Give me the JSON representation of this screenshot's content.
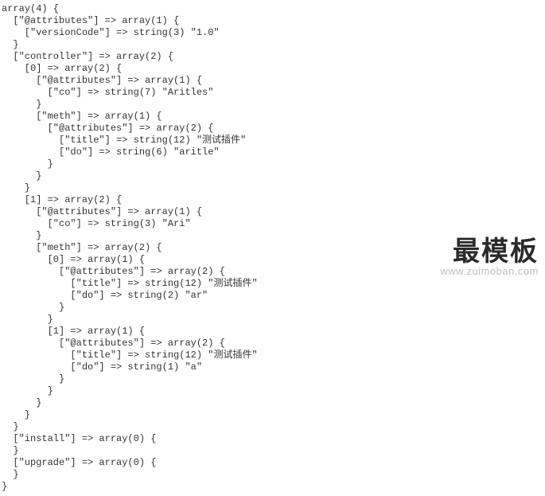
{
  "watermark": {
    "main": "最模板",
    "sub": "www.zuimoban.com"
  },
  "lines": [
    "array(4) {",
    "  [\"@attributes\"] => array(1) {",
    "    [\"versionCode\"] => string(3) \"1.0\"",
    "  }",
    "  [\"controller\"] => array(2) {",
    "    [0] => array(2) {",
    "      [\"@attributes\"] => array(1) {",
    "        [\"co\"] => string(7) \"Aritles\"",
    "      }",
    "      [\"meth\"] => array(1) {",
    "        [\"@attributes\"] => array(2) {",
    "          [\"title\"] => string(12) \"测试插件\"",
    "          [\"do\"] => string(6) \"aritle\"",
    "        }",
    "      }",
    "    }",
    "    [1] => array(2) {",
    "      [\"@attributes\"] => array(1) {",
    "        [\"co\"] => string(3) \"Ari\"",
    "      }",
    "      [\"meth\"] => array(2) {",
    "        [0] => array(1) {",
    "          [\"@attributes\"] => array(2) {",
    "            [\"title\"] => string(12) \"测试插件\"",
    "            [\"do\"] => string(2) \"ar\"",
    "          }",
    "        }",
    "        [1] => array(1) {",
    "          [\"@attributes\"] => array(2) {",
    "            [\"title\"] => string(12) \"测试插件\"",
    "            [\"do\"] => string(1) \"a\"",
    "          }",
    "        }",
    "      }",
    "    }",
    "  }",
    "  [\"install\"] => array(0) {",
    "  }",
    "  [\"upgrade\"] => array(0) {",
    "  }",
    "}"
  ]
}
